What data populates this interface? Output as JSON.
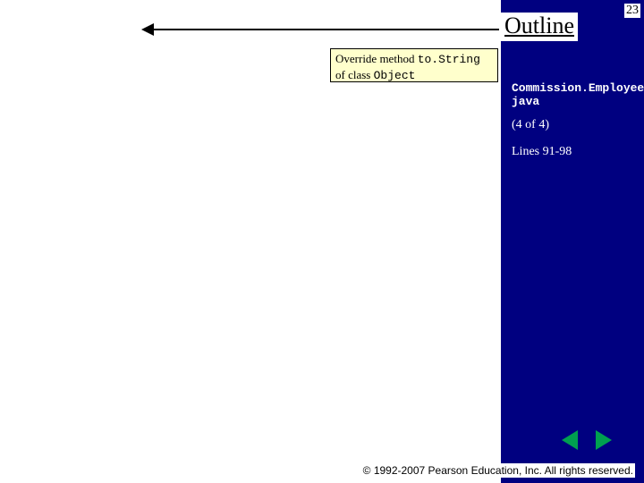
{
  "page_number": "23",
  "outline_title": "Outline",
  "callout": {
    "prefix": "Override method ",
    "code1": "to.String",
    "mid": " of class ",
    "code2": "Object"
  },
  "meta": {
    "filename": "Commission.Employee. java",
    "part": "(4 of 4)",
    "lines": "Lines 91-98"
  },
  "footer": "© 1992-2007 Pearson Education, Inc.  All rights reserved."
}
